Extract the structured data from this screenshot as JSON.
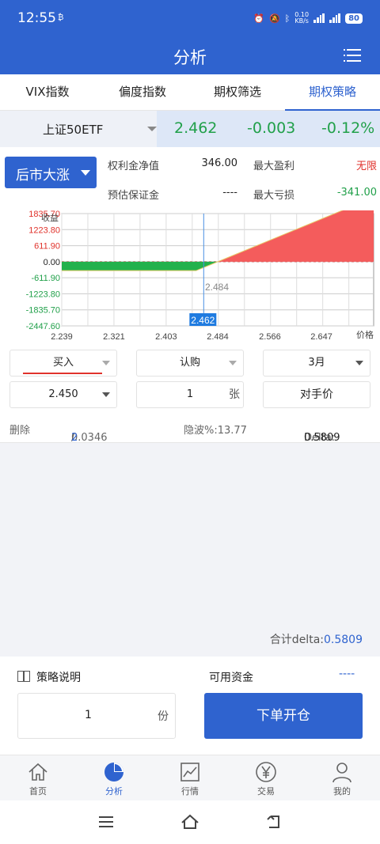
{
  "status": {
    "time": "12:55",
    "time_sub": "₿",
    "net_top": "0.10",
    "net_bottom": "KB/s",
    "battery": "80"
  },
  "header": {
    "title": "分析"
  },
  "tabs": [
    {
      "label": "VIX指数",
      "active": false
    },
    {
      "label": "偏度指数",
      "active": false
    },
    {
      "label": "期权筛选",
      "active": false
    },
    {
      "label": "期权策略",
      "active": true
    }
  ],
  "quote": {
    "name": "上证50ETF",
    "price": "2.462",
    "change": "-0.003",
    "change_pct": "-0.12%"
  },
  "strategy": {
    "direction": "后市大涨",
    "premium_label": "权利金净值",
    "premium_value": "346.00",
    "margin_label": "预估保证金",
    "margin_value": "----",
    "max_profit_label": "最大盈利",
    "max_profit_value": "无限",
    "max_loss_label": "最大亏损",
    "max_loss_value": "-341.00"
  },
  "chart_data": {
    "type": "area",
    "ylabel": "收益",
    "xlabel": "价格",
    "y_ticks": [
      "1835.70",
      "1223.80",
      "611.90",
      "0.00",
      "-611.90",
      "-1223.80",
      "-1835.70",
      "-2447.60"
    ],
    "y_values": [
      1835.7,
      1223.8,
      611.9,
      0,
      -611.9,
      -1223.8,
      -1835.7,
      -2447.6
    ],
    "x_ticks": [
      "2.239",
      "2.321",
      "2.403",
      "2.484",
      "2.566",
      "2.647"
    ],
    "x_values": [
      2.239,
      2.321,
      2.403,
      2.484,
      2.566,
      2.647
    ],
    "xlim": [
      2.239,
      2.729
    ],
    "ylim": [
      -2447.6,
      1835.7
    ],
    "payoff_x": [
      2.239,
      2.45,
      2.484,
      2.729
    ],
    "payoff_y": [
      -341,
      -341,
      0,
      2450
    ],
    "breakeven_label": "2.484",
    "breakeven": 2.484,
    "current_label": "2.462",
    "current": 2.462,
    "colors": {
      "loss": "#22b14c",
      "profit": "#f45c5c",
      "current_line": "#4a90e2"
    }
  },
  "order": {
    "side": "买入",
    "type": "认购",
    "month": "3月",
    "strike": "2.450",
    "quantity": "1",
    "quantity_unit": "张",
    "price_mode": "对手价"
  },
  "detail": {
    "delete": "删除",
    "price": "0.0346",
    "price_sep": "/",
    "price_count": "2",
    "iv": "隐波%:13.77",
    "delta_label": "Delta:",
    "delta_value": "0.5809"
  },
  "total": {
    "label": "合计delta:",
    "value": "0.5809"
  },
  "bottom": {
    "explain": "策略说明",
    "funds_label": "可用资金",
    "funds_value": "----",
    "copies": "1",
    "copies_unit": "份",
    "submit": "下单开仓"
  },
  "nav": [
    {
      "label": "首页",
      "icon": "home-icon"
    },
    {
      "label": "分析",
      "icon": "pie-chart-icon",
      "active": true
    },
    {
      "label": "行情",
      "icon": "line-chart-icon"
    },
    {
      "label": "交易",
      "icon": "yen-icon"
    },
    {
      "label": "我的",
      "icon": "user-icon"
    }
  ]
}
